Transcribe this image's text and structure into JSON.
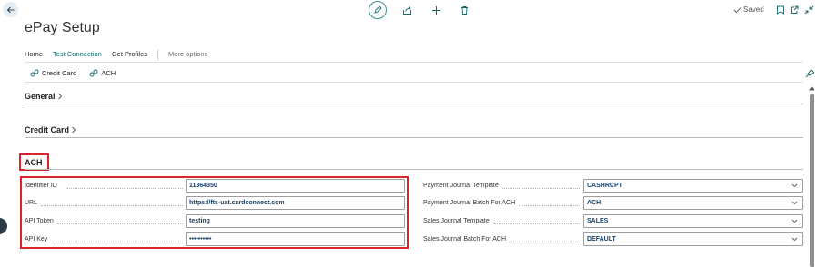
{
  "page": {
    "title": "ePay Setup",
    "saved_label": "Saved"
  },
  "icons": {
    "back": "arrow-left-icon",
    "edit": "pencil-icon",
    "share": "share-icon",
    "new": "plus-icon",
    "delete": "trash-icon",
    "bookmark": "bookmark-icon",
    "open_new": "open-new-window-icon",
    "collapse": "collapse-icon",
    "pin": "pin-icon"
  },
  "actions": {
    "home": "Home",
    "test_connection": "Test Connection",
    "get_profiles": "Get Profiles",
    "more_options": "More options"
  },
  "sub_actions": {
    "credit_card": "Credit Card",
    "ach": "ACH"
  },
  "sections": {
    "general": "General",
    "credit_card": "Credit Card",
    "ach": "ACH"
  },
  "fields_left": [
    {
      "label": "Identifier ID",
      "value": "11364350"
    },
    {
      "label": "URL",
      "value": "https://fts-uat.cardconnect.com"
    },
    {
      "label": "API Token",
      "value": "testing"
    },
    {
      "label": "API Key",
      "value": "••••••••••"
    }
  ],
  "fields_right": [
    {
      "label": "Payment Journal Template",
      "value": "CASHRCPT"
    },
    {
      "label": "Payment Journal Batch For ACH",
      "value": "ACH"
    },
    {
      "label": "Sales Journal Template",
      "value": "SALES"
    },
    {
      "label": "Sales Journal Batch For ACH",
      "value": "DEFAULT"
    }
  ],
  "colors": {
    "accent": "#0f6a6a",
    "highlight_box": "#d9252a",
    "field_value": "#15406b"
  }
}
